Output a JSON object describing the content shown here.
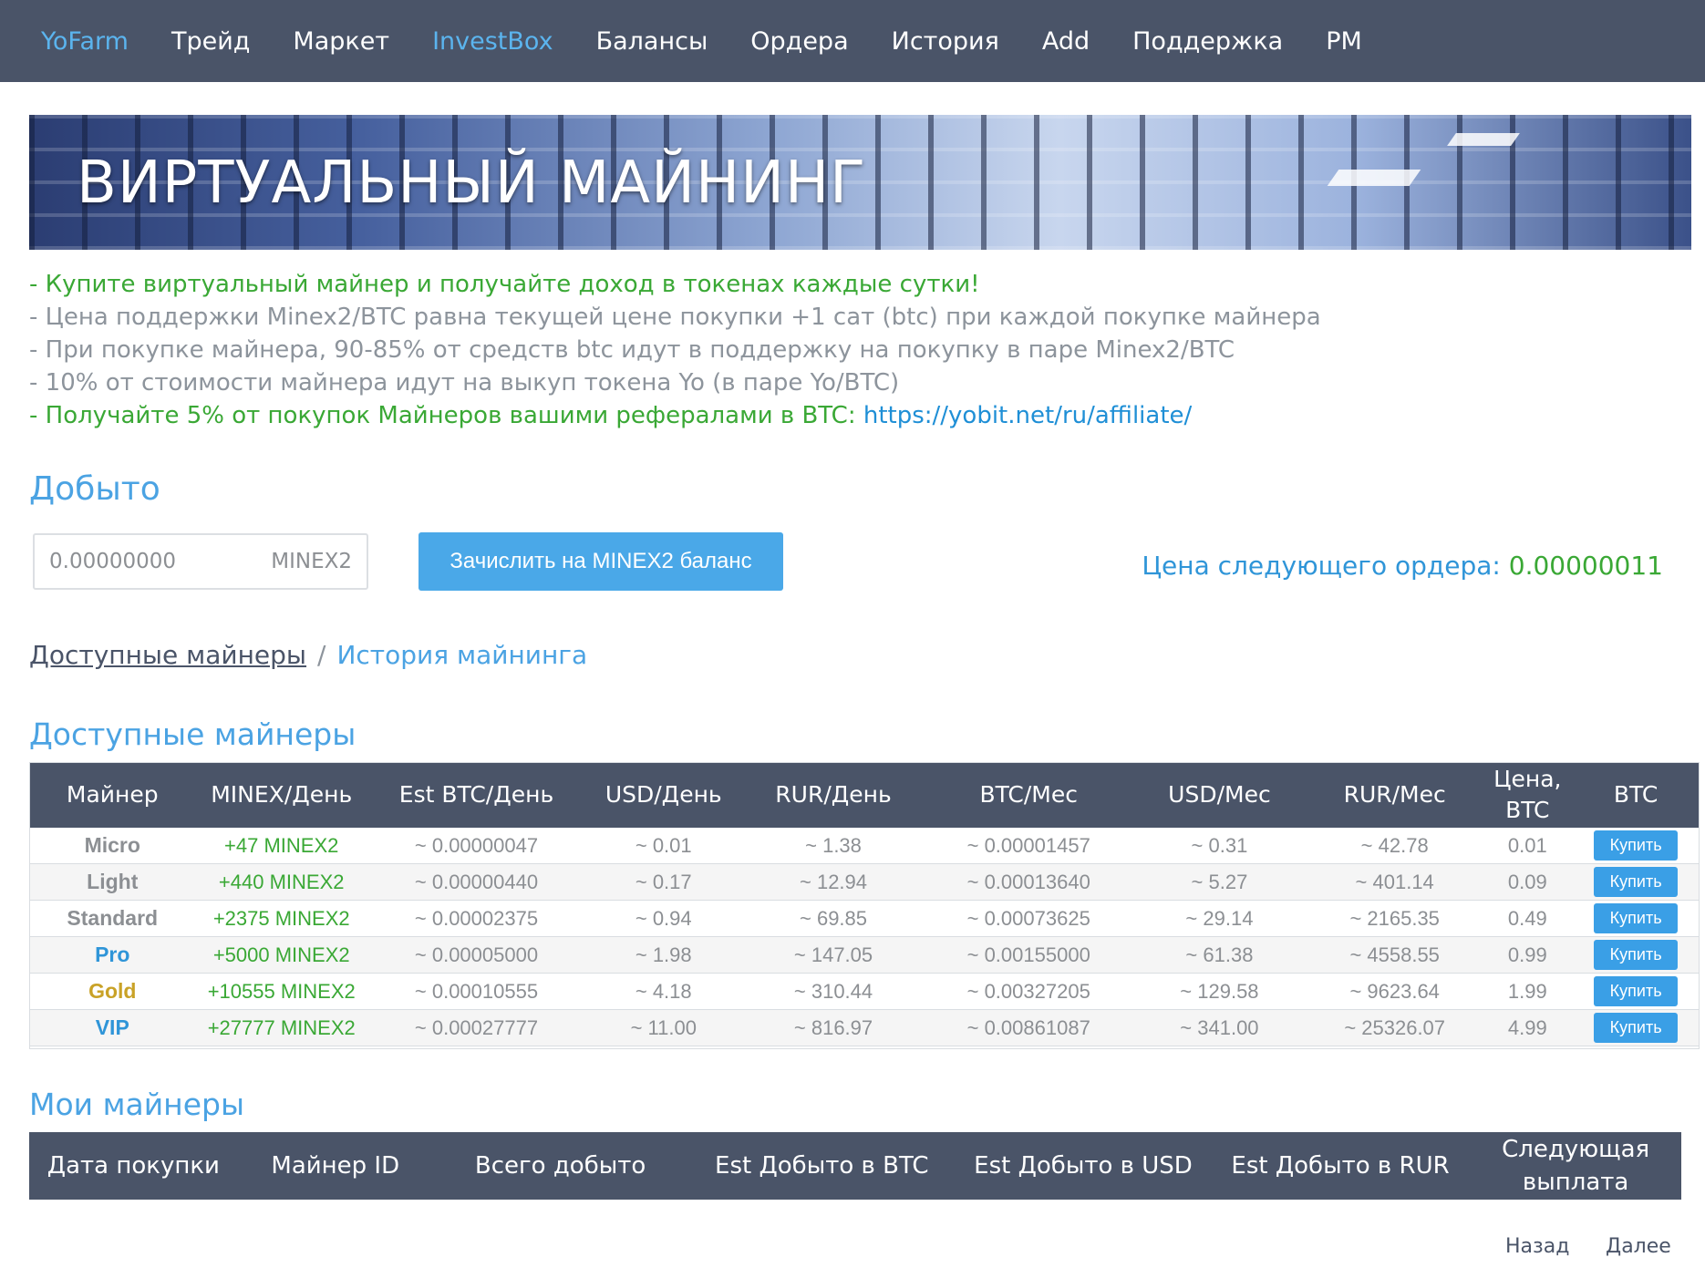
{
  "nav": {
    "items": [
      {
        "label": "YoFarm",
        "active": true
      },
      {
        "label": "Трейд",
        "active": false
      },
      {
        "label": "Маркет",
        "active": false
      },
      {
        "label": "InvestBox",
        "active": true
      },
      {
        "label": "Балансы",
        "active": false
      },
      {
        "label": "Ордера",
        "active": false
      },
      {
        "label": "История",
        "active": false
      },
      {
        "label": "Add",
        "active": false
      },
      {
        "label": "Поддержка",
        "active": false
      },
      {
        "label": "PM",
        "active": false
      }
    ]
  },
  "banner": {
    "title": "ВИРТУАЛЬНЫЙ МАЙНИНГ"
  },
  "info": {
    "line1": "- Купите виртуальный майнер и получайте доход в токенах каждые сутки!",
    "line2": "- Цена поддержки Minex2/BTC равна текущей цене покупки +1 сат (btc) при каждой покупке майнера",
    "line3": "- При покупке майнера, 90-85% от средств btc идут в поддержку на покупку в паре Minex2/BTC",
    "line4": "- 10% от стоимости майнера идут на выкуп токена Yo (в паре Yo/BTC)",
    "line5_text": "- Получайте 5% от покупок Майнеров вашими рефералами в BTC: ",
    "line5_link": "https://yobit.net/ru/affiliate/"
  },
  "mined": {
    "heading": "Добыто",
    "input_placeholder": "0.00000000",
    "input_unit": "MINEX2",
    "credit_button": "Зачислить на MINEX2 баланс",
    "next_price_label": "Цена следующего ордера: ",
    "next_price_value": "0.00000011"
  },
  "crumbs": {
    "current": "Доступные майнеры",
    "separator": "/",
    "link": "История майнинга"
  },
  "available": {
    "heading": "Доступные майнеры",
    "headers": [
      "Майнер",
      "MINEX/День",
      "Est BTC/День",
      "USD/День",
      "RUR/День",
      "BTC/Мес",
      "USD/Мес",
      "RUR/Мес",
      "Цена, BTC",
      "BTC"
    ],
    "rows": [
      {
        "name": "Micro",
        "color": "#8c8f93",
        "minex": "+47 MINEX2",
        "btc_day": "~ 0.00000047",
        "usd_day": "~ 0.01",
        "rur_day": "~ 1.38",
        "btc_mon": "~ 0.00001457",
        "usd_mon": "~ 0.31",
        "rur_mon": "~ 42.78",
        "price": "0.01",
        "buy": "Купить"
      },
      {
        "name": "Light",
        "color": "#8c8f93",
        "minex": "+440 MINEX2",
        "btc_day": "~ 0.00000440",
        "usd_day": "~ 0.17",
        "rur_day": "~ 12.94",
        "btc_mon": "~ 0.00013640",
        "usd_mon": "~ 5.27",
        "rur_mon": "~ 401.14",
        "price": "0.09",
        "buy": "Купить"
      },
      {
        "name": "Standard",
        "color": "#8c8f93",
        "minex": "+2375 MINEX2",
        "btc_day": "~ 0.00002375",
        "usd_day": "~ 0.94",
        "rur_day": "~ 69.85",
        "btc_mon": "~ 0.00073625",
        "usd_mon": "~ 29.14",
        "rur_mon": "~ 2165.35",
        "price": "0.49",
        "buy": "Купить"
      },
      {
        "name": "Pro",
        "color": "#2f95d8",
        "minex": "+5000 MINEX2",
        "btc_day": "~ 0.00005000",
        "usd_day": "~ 1.98",
        "rur_day": "~ 147.05",
        "btc_mon": "~ 0.00155000",
        "usd_mon": "~ 61.38",
        "rur_mon": "~ 4558.55",
        "price": "0.99",
        "buy": "Купить"
      },
      {
        "name": "Gold",
        "color": "#c9a227",
        "minex": "+10555 MINEX2",
        "btc_day": "~ 0.00010555",
        "usd_day": "~ 4.18",
        "rur_day": "~ 310.44",
        "btc_mon": "~ 0.00327205",
        "usd_mon": "~ 129.58",
        "rur_mon": "~ 9623.64",
        "price": "1.99",
        "buy": "Купить"
      },
      {
        "name": "VIP",
        "color": "#2f95d8",
        "minex": "+27777 MINEX2",
        "btc_day": "~ 0.00027777",
        "usd_day": "~ 11.00",
        "rur_day": "~ 816.97",
        "btc_mon": "~ 0.00861087",
        "usd_mon": "~ 341.00",
        "rur_mon": "~ 25326.07",
        "price": "4.99",
        "buy": "Купить"
      }
    ]
  },
  "mine": {
    "heading": "Мои майнеры",
    "headers": [
      "Дата покупки",
      "Майнер ID",
      "Всего добыто",
      "Est Добыто в BTC",
      "Est Добыто в USD",
      "Est Добыто в RUR",
      "Следующая выплата"
    ]
  },
  "pager": {
    "back": "Назад",
    "next": "Далее"
  },
  "colors": {
    "nav_bg": "#4a5468",
    "accent": "#4ba3e3",
    "green": "#3aa835",
    "button": "#4aa8e8"
  }
}
